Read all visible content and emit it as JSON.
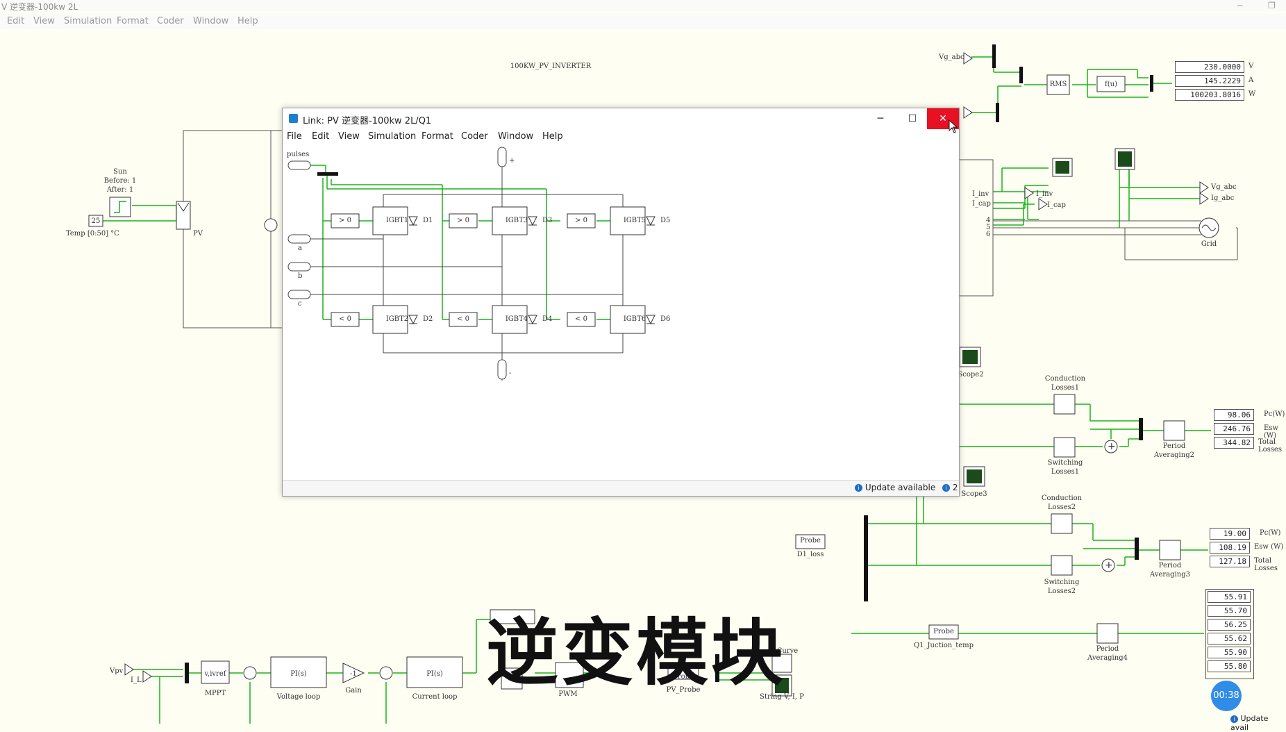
{
  "background_window": {
    "title": "V 逆变器-100kw 2L",
    "menu": [
      "Edit",
      "View",
      "Simulation",
      "Format",
      "Coder",
      "Window",
      "Help"
    ],
    "model_label": "100KW_PV_INVERTER"
  },
  "dialog": {
    "title": "Link: PV 逆变器-100kw 2L/Q1",
    "menu": [
      "File",
      "Edit",
      "View",
      "Simulation",
      "Format",
      "Coder",
      "Window",
      "Help"
    ],
    "status_text": "Update available",
    "status_count": "2",
    "schematic": {
      "pulses_label": "pulses",
      "phase_labels": [
        "a",
        "b",
        "c"
      ],
      "dc_pos": "+",
      "dc_neg": "-",
      "upper_comparators": [
        "> 0",
        "> 0",
        "> 0"
      ],
      "lower_comparators": [
        "< 0",
        "< 0",
        "< 0"
      ],
      "upper_igbts": [
        "IGBT1",
        "IGBT3",
        "IGBT5"
      ],
      "lower_igbts": [
        "IGBT2",
        "IGBT4",
        "IGBT6"
      ],
      "upper_diodes": [
        "D1",
        "D3",
        "D5"
      ],
      "lower_diodes": [
        "D2",
        "D4",
        "D6"
      ]
    }
  },
  "canvas_labels": {
    "sun": "Sun",
    "sun_before": "Before: 1",
    "sun_after": "After: 1",
    "temp_value": "25",
    "temp_label": "Temp [0:50] °C",
    "pv": "PV",
    "vg_abc": "Vg_abc",
    "rms": "RMS",
    "fu": "f(u)",
    "i_inv": "I_inv",
    "i_cap": "I_cap",
    "i_inv_out": "I_inv",
    "i_cap_out": "I_cap",
    "vg_abc_out": "Vg_abc",
    "ig_abc_out": "Ig_abc",
    "ports": [
      "4",
      "5",
      "6"
    ],
    "grid": "Grid",
    "scope2": "Scope2",
    "scope3": "Scope3",
    "conduction1": [
      "Conduction",
      "Losses1"
    ],
    "switching1": [
      "Switching",
      "Losses1"
    ],
    "period2": [
      "Period",
      "Averaging2"
    ],
    "conduction2": [
      "Conduction",
      "Losses2"
    ],
    "switching2": [
      "Switching",
      "Losses2"
    ],
    "period3": [
      "Period",
      "Averaging3"
    ],
    "period4": [
      "Period",
      "Averaging4"
    ],
    "probe_d1": "Probe",
    "probe_d1_name": "D1_loss",
    "probe_q1": "Probe",
    "probe_q1_name": "Q1_Juction_temp",
    "probe_pv": "Probe",
    "probe_pv_name": "PV_Probe",
    "vpv": "Vpv",
    "il": "I_L",
    "mppt": "MPPT",
    "mppt_inner": "v,ivref",
    "pi1": "PI(s)",
    "voltage_loop": "Voltage loop",
    "gain_val": "-1",
    "gain": "Gain",
    "pi2": "PI(s)",
    "current_loop": "Current loop",
    "pwm": "PWM",
    "curve": "Curve",
    "string_vip": "String V, I, P"
  },
  "displays": {
    "grid_meter": [
      {
        "value": "230.0000",
        "unit": "V"
      },
      {
        "value": "145.2229",
        "unit": "A"
      },
      {
        "value": "100203.8016",
        "unit": "W"
      }
    ],
    "losses1": [
      {
        "value": "98.06",
        "unit": "Pc(W)"
      },
      {
        "value": "246.76",
        "unit": "Esw (W)"
      },
      {
        "value": "344.82",
        "unit": "Total Losses"
      }
    ],
    "losses2": [
      {
        "value": "19.00",
        "unit": "Pc(W)"
      },
      {
        "value": "108.19",
        "unit": "Esw (W)"
      },
      {
        "value": "127.18",
        "unit": "Total Losses"
      }
    ],
    "temps": [
      "55.91",
      "55.70",
      "56.25",
      "55.62",
      "55.90",
      "55.80"
    ]
  },
  "overlay": {
    "caption": "逆变模块",
    "timer": "00:38",
    "bottom_status": "Update avail"
  },
  "colors": {
    "wire": "#19b319",
    "close": "#e81123",
    "accent": "#1e7fd0"
  }
}
